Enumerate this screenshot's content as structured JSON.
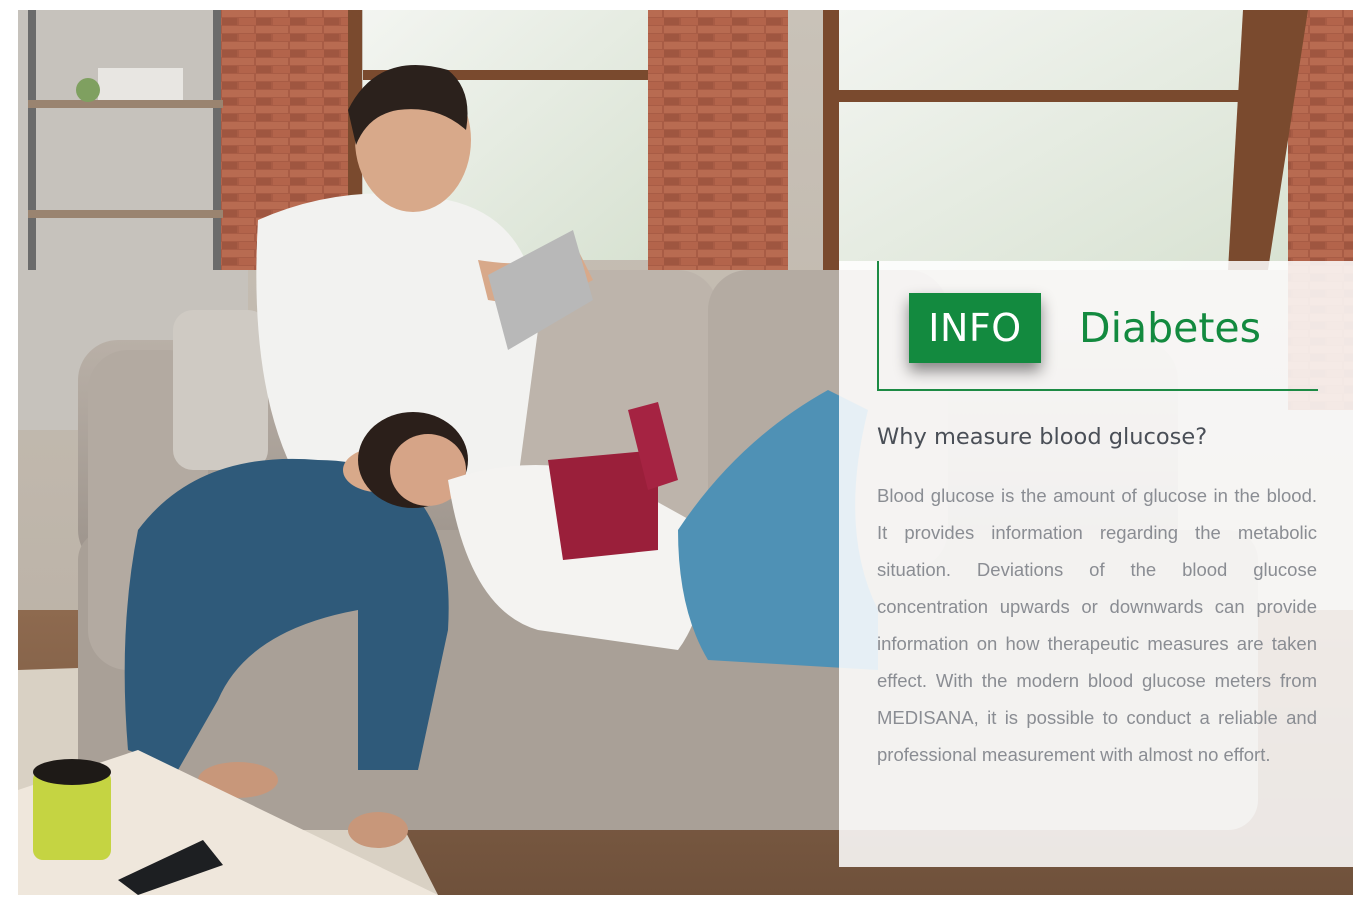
{
  "info_box": {
    "badge": "INFO",
    "title": "Diabetes",
    "subtitle": "Why measure blood glucose?",
    "body": "Blood glucose is the amount of glucose in the blood. It provides information regarding the metabolic situation. Deviations of the blood glucose concentration upwards or downwards can provide information on how therapeutic measures are taken effect. With the modern blood glucose meters from MEDISANA, it is possible to conduct a reliable and professional measurement with almost no effort."
  },
  "colors": {
    "brand_green": "#138a3f",
    "panel_background": "#ffffff",
    "subtitle_text": "#4a4f57",
    "body_text": "#8a8d93"
  },
  "photo": {
    "subject": "couple-relaxing-on-sofa"
  }
}
